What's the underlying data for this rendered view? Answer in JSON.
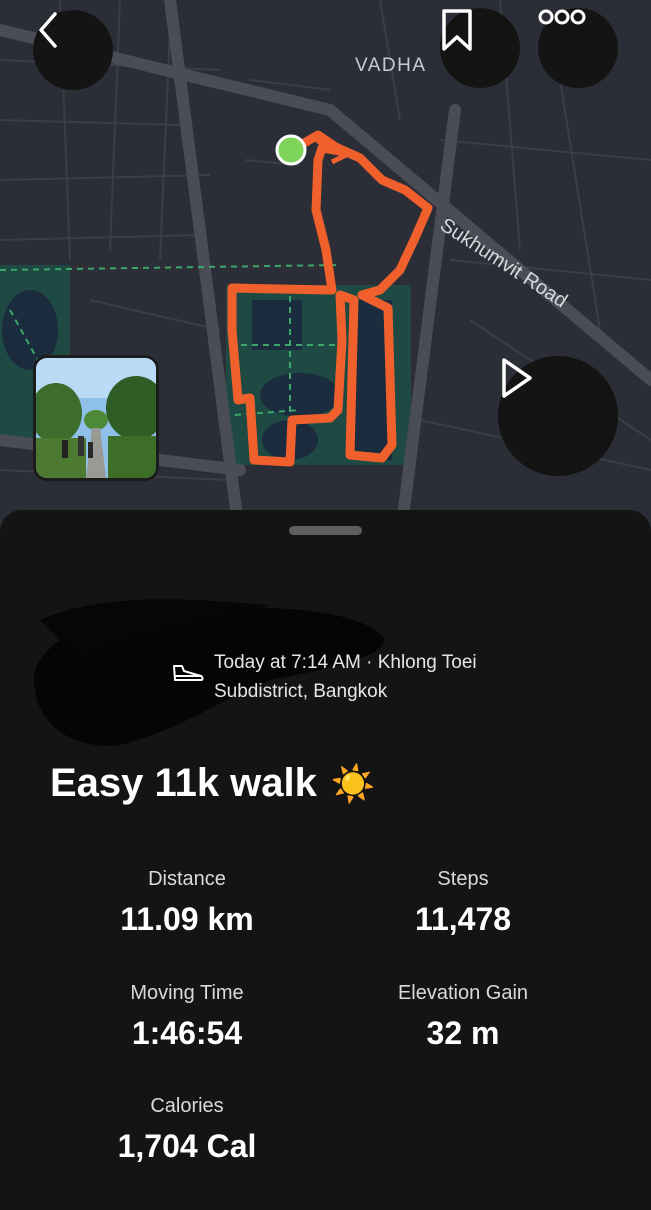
{
  "map": {
    "area_label": "VADHA",
    "road_label": "Sukhumvit Road",
    "colors": {
      "route": "#f0602c",
      "start": "#7ed35a",
      "park": "#1f4a44",
      "water": "#1a2c3e",
      "road": "#4a4d56"
    }
  },
  "header": {
    "back_icon": "chevron-left-icon",
    "bookmark_icon": "bookmark-icon",
    "more_icon": "more-dots-icon",
    "play_icon": "play-icon"
  },
  "activity": {
    "when_where_line1": "Today at 7:14 AM · Khlong Toei",
    "when_where_line2": "Subdistrict, Bangkok",
    "activity_icon": "shoe-icon",
    "title": "Easy 11k walk",
    "title_emoji": "☀️"
  },
  "stats": {
    "distance": {
      "label": "Distance",
      "value": "11.09 km"
    },
    "steps": {
      "label": "Steps",
      "value": "11,478"
    },
    "moving_time": {
      "label": "Moving Time",
      "value": "1:46:54"
    },
    "elevation_gain": {
      "label": "Elevation Gain",
      "value": "32 m"
    },
    "calories": {
      "label": "Calories",
      "value": "1,704 Cal"
    }
  }
}
